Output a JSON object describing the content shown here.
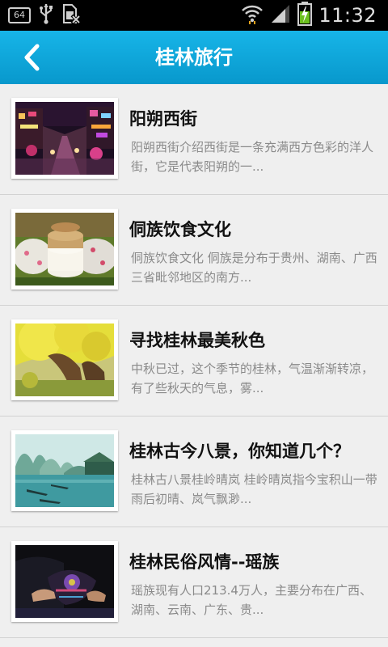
{
  "status_bar": {
    "badge": "64",
    "time": "11:32",
    "icons": [
      "usb-icon",
      "no-sim-icon",
      "wifi-icon",
      "signal-icon",
      "battery-charging-icon"
    ]
  },
  "header": {
    "title": "桂林旅行",
    "back_icon": "chevron-left-icon",
    "color": "#0fa8de"
  },
  "articles": [
    {
      "title": "阳朔西街",
      "desc": "阳朔西街介绍西街是一条充满西方色彩的洋人街，它是代表阳朔的一...",
      "image": "night-street-photo"
    },
    {
      "title": "侗族饮食文化",
      "desc": "侗族饮食文化 侗族是分布于贵州、湖南、广西三省毗邻地区的南方...",
      "image": "rice-cakes-photo"
    },
    {
      "title": "寻找桂林最美秋色",
      "desc": "中秋已过，这个季节的桂林，气温渐渐转凉，有了些秋天的气息，雾...",
      "image": "autumn-tree-photo"
    },
    {
      "title": "桂林古今八景，你知道几个？",
      "desc": "桂林古八景桂岭晴岚 桂岭晴岚指今宝积山一带雨后初晴、岚气飘渺...",
      "image": "river-boats-photo"
    },
    {
      "title": "桂林民俗风情--瑶族",
      "desc": "瑶族现有人口213.4万人，主要分布在广西、湖南、云南、广东、贵...",
      "image": "embroidery-photo"
    }
  ]
}
